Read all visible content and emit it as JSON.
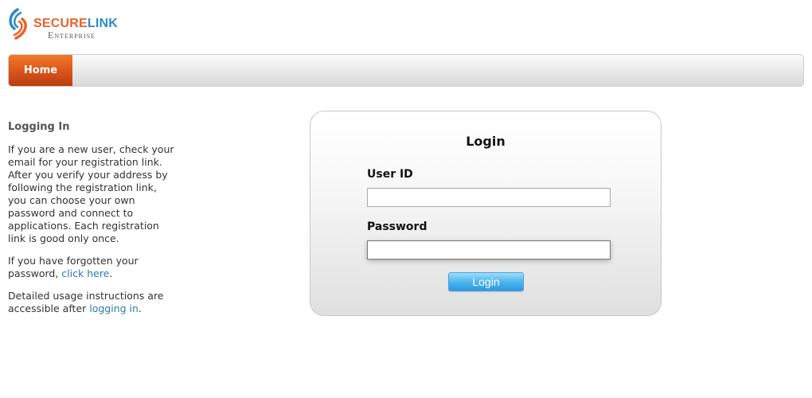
{
  "logo": {
    "brand_part1": "SECURE",
    "brand_part2": "LINK",
    "subtitle": "Enterprise",
    "icon": "securelink-swirl-icon",
    "colors": {
      "orange": "#e8622a",
      "blue": "#2d8bc8"
    }
  },
  "nav": {
    "home_label": "Home",
    "accent": "#d9531a"
  },
  "info": {
    "heading": "Logging In",
    "para1": "If you are a new user, check your email for your registration link. After you verify your address by following the registration link, you can choose your own password and connect to applications. Each registration link is good only once.",
    "para2_before": "If you have forgotten your password, ",
    "para2_link": "click here",
    "para2_after": ".",
    "para3_before": "Detailed usage instructions are accessible after ",
    "para3_link": "logging in",
    "para3_after": "."
  },
  "login": {
    "title": "Login",
    "user_label": "User ID",
    "user_value": "",
    "password_label": "Password",
    "password_value": "",
    "button_label": "Login",
    "button_color": "#4fb6ee"
  }
}
